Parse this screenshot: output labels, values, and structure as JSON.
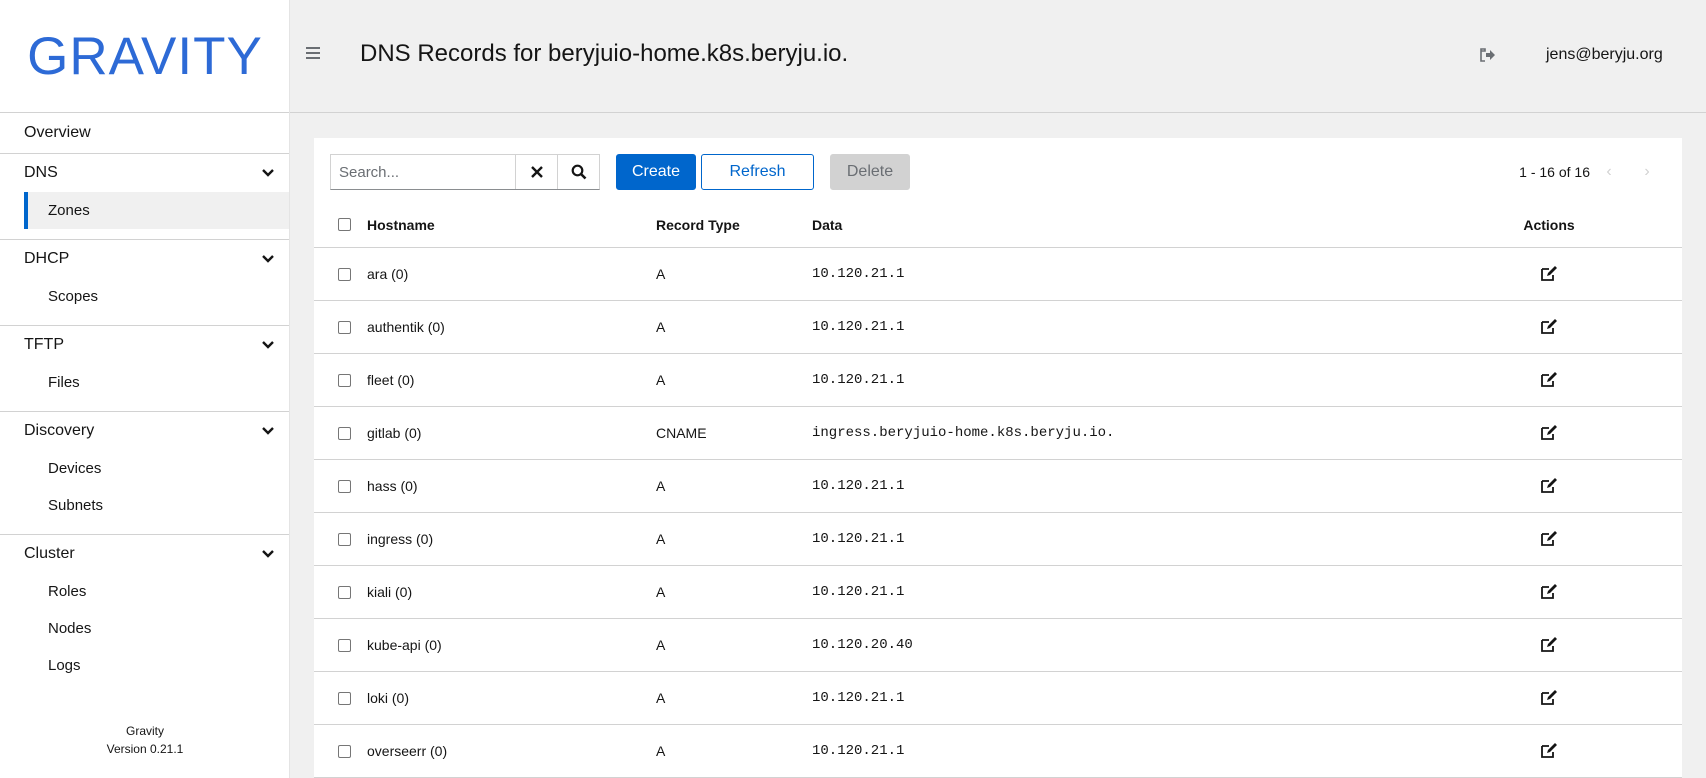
{
  "app": {
    "logo_text": "GRAVITY",
    "brand_color": "#2d6ad6",
    "accent_color": "#0066cc"
  },
  "sidebar": {
    "overview": "Overview",
    "groups": [
      {
        "label": "DNS",
        "items": [
          "Zones"
        ]
      },
      {
        "label": "DHCP",
        "items": [
          "Scopes"
        ]
      },
      {
        "label": "TFTP",
        "items": [
          "Files"
        ]
      },
      {
        "label": "Discovery",
        "items": [
          "Devices",
          "Subnets"
        ]
      },
      {
        "label": "Cluster",
        "items": [
          "Roles",
          "Nodes",
          "Logs"
        ]
      }
    ],
    "active_item": "Zones",
    "footer_name": "Gravity",
    "footer_version": "Version 0.21.1"
  },
  "header": {
    "title": "DNS Records for beryjuio-home.k8s.beryju.io.",
    "user": "jens@beryju.org",
    "menu_icon": "hamburger-icon",
    "logout_icon": "logout-icon"
  },
  "toolbar": {
    "search_placeholder": "Search...",
    "search_value": "",
    "create_label": "Create",
    "refresh_label": "Refresh",
    "delete_label": "Delete",
    "pagination_text": "1 - 16 of 16"
  },
  "table": {
    "columns": {
      "hostname": "Hostname",
      "type": "Record Type",
      "data": "Data",
      "actions": "Actions"
    },
    "rows": [
      {
        "hostname": "ara (0)",
        "type": "A",
        "data": "10.120.21.1"
      },
      {
        "hostname": "authentik (0)",
        "type": "A",
        "data": "10.120.21.1"
      },
      {
        "hostname": "fleet (0)",
        "type": "A",
        "data": "10.120.21.1"
      },
      {
        "hostname": "gitlab (0)",
        "type": "CNAME",
        "data": "ingress.beryjuio-home.k8s.beryju.io."
      },
      {
        "hostname": "hass (0)",
        "type": "A",
        "data": "10.120.21.1"
      },
      {
        "hostname": "ingress (0)",
        "type": "A",
        "data": "10.120.21.1"
      },
      {
        "hostname": "kiali (0)",
        "type": "A",
        "data": "10.120.21.1"
      },
      {
        "hostname": "kube-api (0)",
        "type": "A",
        "data": "10.120.20.40"
      },
      {
        "hostname": "loki (0)",
        "type": "A",
        "data": "10.120.21.1"
      },
      {
        "hostname": "overseerr (0)",
        "type": "A",
        "data": "10.120.21.1"
      }
    ]
  }
}
